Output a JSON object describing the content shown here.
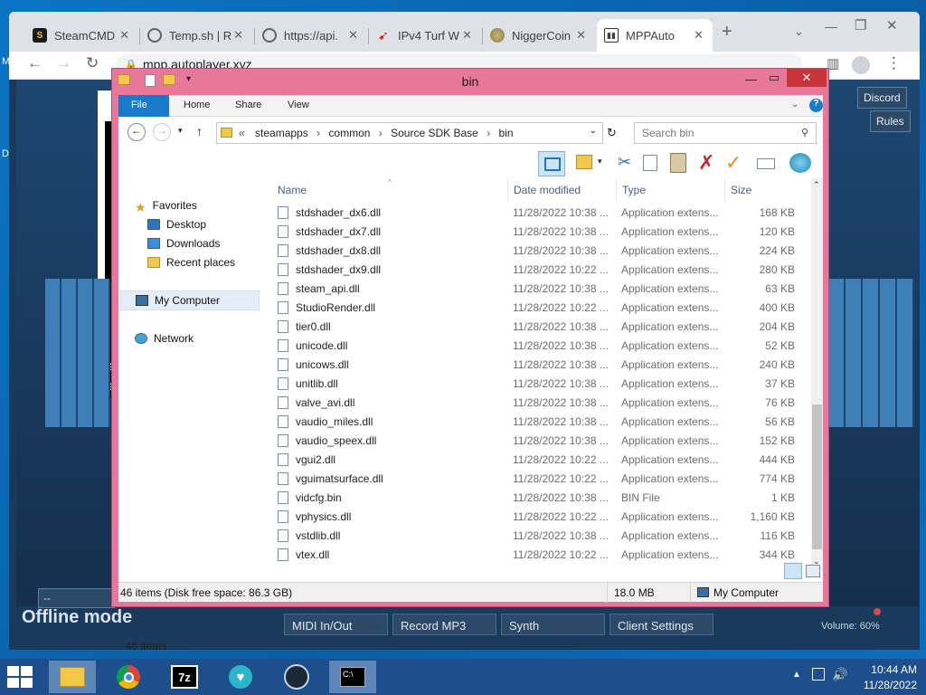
{
  "desktop": {
    "left_marks": [
      "M",
      "D"
    ]
  },
  "browser": {
    "tabs": [
      {
        "title": "SteamCMD",
        "favicon": "steam-s-icon"
      },
      {
        "title": "Temp.sh | R",
        "favicon": "globe-icon"
      },
      {
        "title": "https://api.",
        "favicon": "globe-icon"
      },
      {
        "title": "IPv4 Turf W",
        "favicon": "red-arrow-icon"
      },
      {
        "title": "NiggerCoin",
        "favicon": "coin-icon"
      },
      {
        "title": "MPPAuto",
        "favicon": "piano-icon",
        "active": true
      }
    ],
    "new_tab_label": "+",
    "url": "mpp.autoplayer.xyz"
  },
  "webpage": {
    "side_buttons": [
      "Discord",
      "Rules"
    ],
    "offline_label": "Offline mode",
    "input_value": "--",
    "side_letters": [
      "S",
      "S"
    ],
    "bottom_buttons": [
      "MIDI In/Out",
      "Record MP3",
      "Synth",
      "Client Settings"
    ],
    "volume_label": "Volume: 60%"
  },
  "explorer": {
    "title": "bin",
    "ribbon_tabs": [
      "File",
      "Home",
      "Share",
      "View"
    ],
    "breadcrumb": [
      "steamapps",
      "common",
      "Source SDK Base",
      "bin"
    ],
    "breadcrumb_prefix": "«",
    "search_placeholder": "Search bin",
    "nav": {
      "favorites": "Favorites",
      "favorites_items": [
        "Desktop",
        "Downloads",
        "Recent places"
      ],
      "computer": "My Computer",
      "network": "Network"
    },
    "columns": [
      "Name",
      "Date modified",
      "Type",
      "Size"
    ],
    "files": [
      {
        "name": "stdshader_dx6.dll",
        "date": "11/28/2022 10:38 ...",
        "type": "Application extens...",
        "size": "168 KB"
      },
      {
        "name": "stdshader_dx7.dll",
        "date": "11/28/2022 10:38 ...",
        "type": "Application extens...",
        "size": "120 KB"
      },
      {
        "name": "stdshader_dx8.dll",
        "date": "11/28/2022 10:38 ...",
        "type": "Application extens...",
        "size": "224 KB"
      },
      {
        "name": "stdshader_dx9.dll",
        "date": "11/28/2022 10:22 ...",
        "type": "Application extens...",
        "size": "280 KB"
      },
      {
        "name": "steam_api.dll",
        "date": "11/28/2022 10:38 ...",
        "type": "Application extens...",
        "size": "63 KB"
      },
      {
        "name": "StudioRender.dll",
        "date": "11/28/2022 10:22 ...",
        "type": "Application extens...",
        "size": "400 KB"
      },
      {
        "name": "tier0.dll",
        "date": "11/28/2022 10:38 ...",
        "type": "Application extens...",
        "size": "204 KB"
      },
      {
        "name": "unicode.dll",
        "date": "11/28/2022 10:38 ...",
        "type": "Application extens...",
        "size": "52 KB"
      },
      {
        "name": "unicows.dll",
        "date": "11/28/2022 10:38 ...",
        "type": "Application extens...",
        "size": "240 KB"
      },
      {
        "name": "unitlib.dll",
        "date": "11/28/2022 10:38 ...",
        "type": "Application extens...",
        "size": "37 KB"
      },
      {
        "name": "valve_avi.dll",
        "date": "11/28/2022 10:38 ...",
        "type": "Application extens...",
        "size": "76 KB"
      },
      {
        "name": "vaudio_miles.dll",
        "date": "11/28/2022 10:38 ...",
        "type": "Application extens...",
        "size": "56 KB"
      },
      {
        "name": "vaudio_speex.dll",
        "date": "11/28/2022 10:38 ...",
        "type": "Application extens...",
        "size": "152 KB"
      },
      {
        "name": "vgui2.dll",
        "date": "11/28/2022 10:22 ...",
        "type": "Application extens...",
        "size": "444 KB"
      },
      {
        "name": "vguimatsurface.dll",
        "date": "11/28/2022 10:22 ...",
        "type": "Application extens...",
        "size": "774 KB"
      },
      {
        "name": "vidcfg.bin",
        "date": "11/28/2022 10:38 ...",
        "type": "BIN File",
        "size": "1 KB"
      },
      {
        "name": "vphysics.dll",
        "date": "11/28/2022 10:22 ...",
        "type": "Application extens...",
        "size": "1,160 KB"
      },
      {
        "name": "vstdlib.dll",
        "date": "11/28/2022 10:38 ...",
        "type": "Application extens...",
        "size": "116 KB"
      },
      {
        "name": "vtex.dll",
        "date": "11/28/2022 10:22 ...",
        "type": "Application extens...",
        "size": "344 KB"
      }
    ],
    "item_count": "46 items",
    "status_left": "46 items (Disk free space: 86.3 GB)",
    "status_size": "18.0 MB",
    "status_location": "My Computer",
    "title_colors": {
      "frame": "#e9769b",
      "accent": "#1979ca"
    }
  },
  "taskbar": {
    "apps": [
      "file-explorer-icon",
      "chrome-icon",
      "7zip-icon",
      "vpn-icon",
      "steam-icon",
      "cmd-icon"
    ],
    "time": "10:44 AM",
    "date": "11/28/2022"
  }
}
